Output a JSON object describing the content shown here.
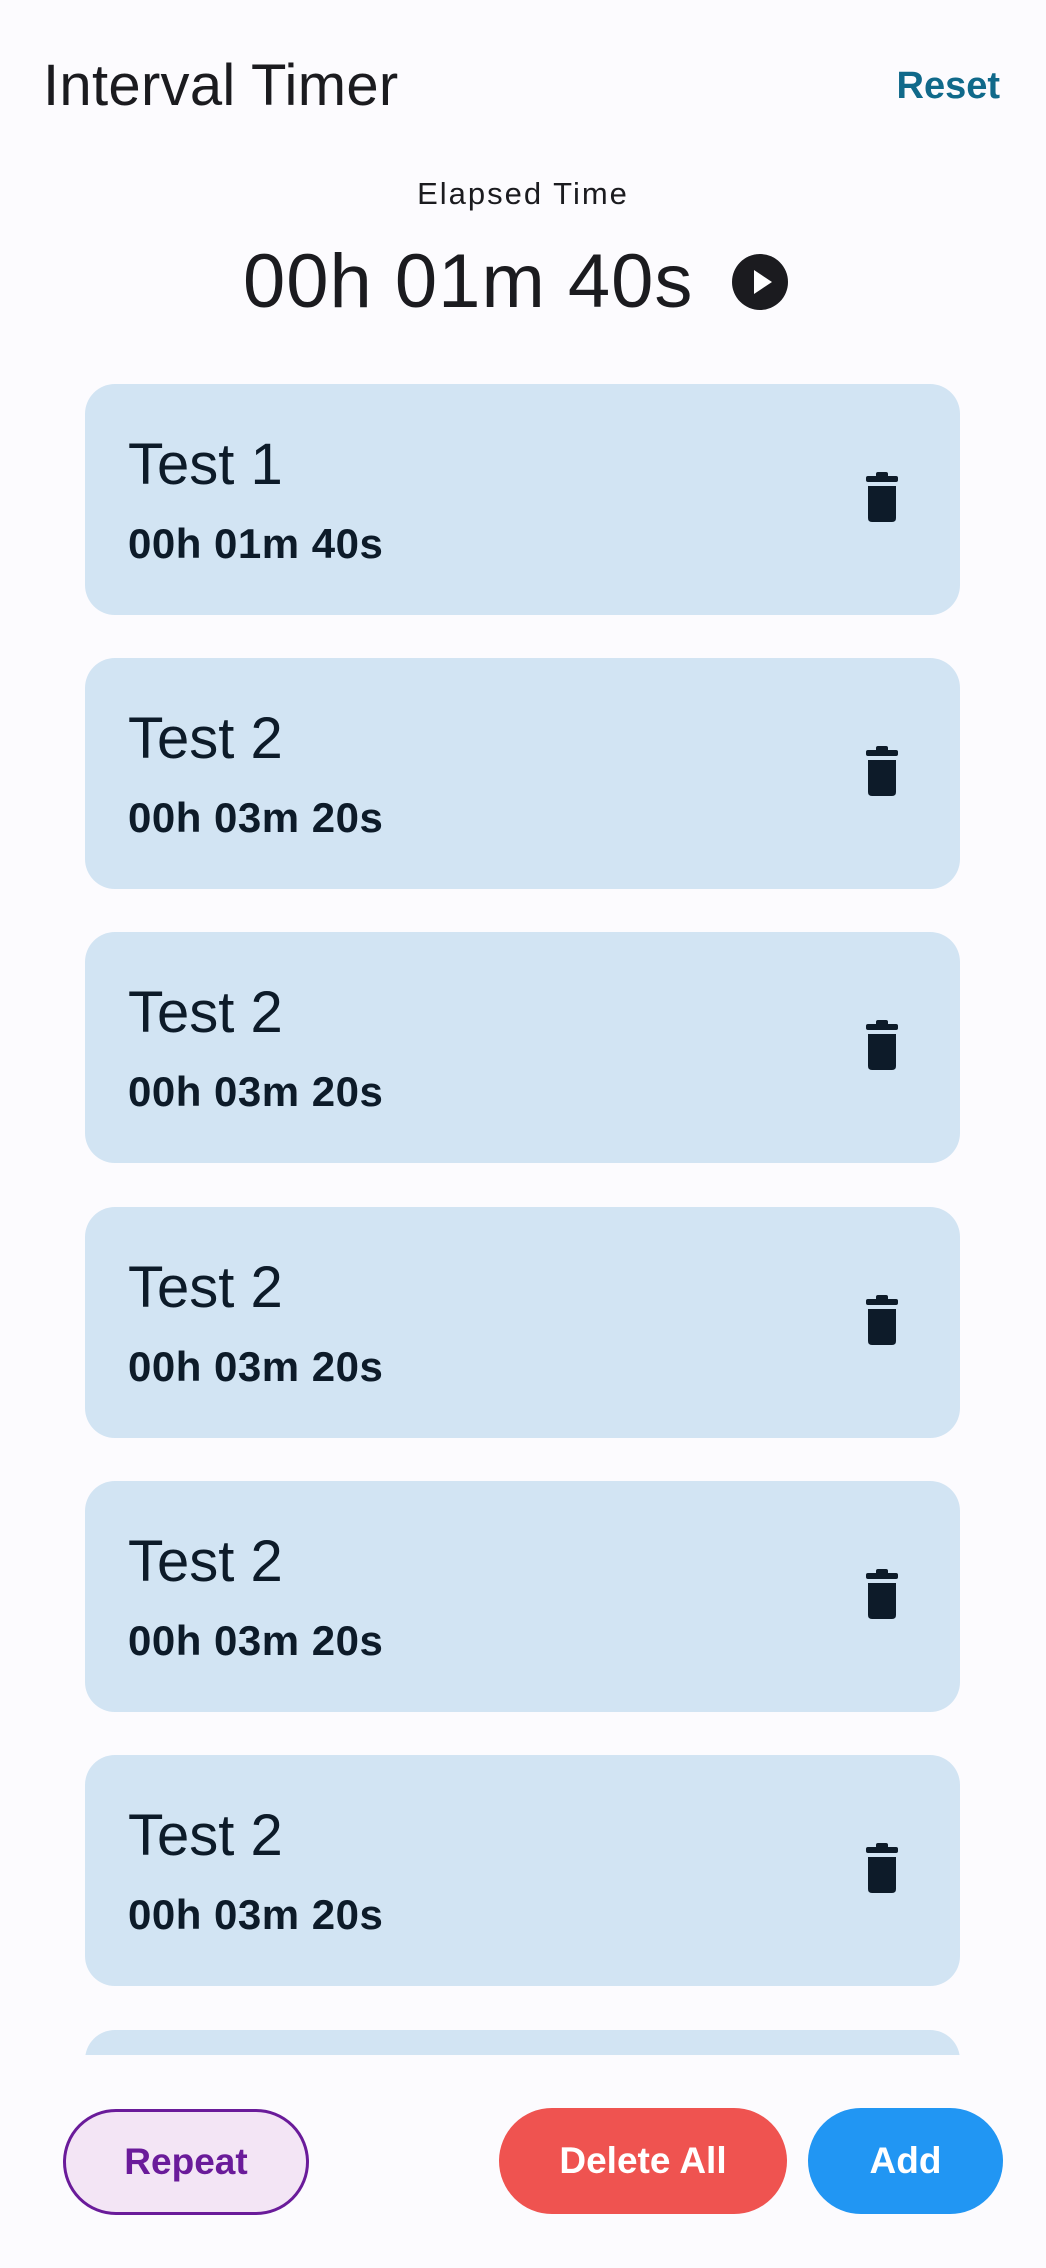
{
  "header": {
    "title": "Interval Timer",
    "reset_label": "Reset"
  },
  "elapsed": {
    "label": "Elapsed Time",
    "value": "00h 01m 40s",
    "play_icon": "play-circle-icon"
  },
  "intervals": [
    {
      "name": "Test 1",
      "duration": "00h 01m 40s"
    },
    {
      "name": "Test 2",
      "duration": "00h 03m 20s"
    },
    {
      "name": "Test 2",
      "duration": "00h 03m 20s"
    },
    {
      "name": "Test 2",
      "duration": "00h 03m 20s"
    },
    {
      "name": "Test 2",
      "duration": "00h 03m 20s"
    },
    {
      "name": "Test 2",
      "duration": "00h 03m 20s"
    },
    {
      "name": "",
      "duration": ""
    }
  ],
  "delete_icon": "trash-icon",
  "footer": {
    "repeat_label": "Repeat",
    "delete_all_label": "Delete All",
    "add_label": "Add"
  },
  "colors": {
    "background": "#fcfbfe",
    "card": "#d2e4f3",
    "accent_reset": "#10698a",
    "repeat_border": "#6a1b9a",
    "repeat_fill": "#f3e5f5",
    "delete_all": "#ef5350",
    "add": "#2196f3"
  }
}
